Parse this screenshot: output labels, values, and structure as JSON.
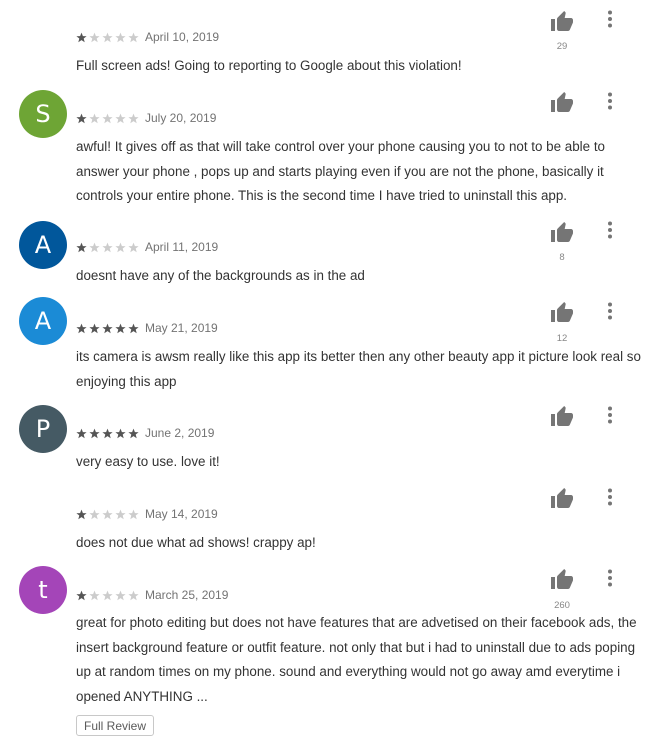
{
  "colors": {
    "star_on": "#555555",
    "star_off": "#cccccc",
    "icon": "#757575"
  },
  "reviews": [
    {
      "initial": "",
      "avatar_color": "",
      "rating": 1,
      "date": "April 10, 2019",
      "likes": "29",
      "text": "Full screen ads! Going to reporting to Google about this violation!"
    },
    {
      "initial": "S",
      "avatar_color": "#6ea535",
      "rating": 1,
      "date": "July 20, 2019",
      "likes": "",
      "text": "awful! It gives off as that will take control over your phone causing you to not to be able to answer your phone , pops up and starts playing even if you are not the phone, basically it controls your entire phone. This is the second time I have tried to uninstall this app."
    },
    {
      "initial": "A",
      "avatar_color": "#01579b",
      "rating": 1,
      "date": "April 11, 2019",
      "likes": "8",
      "text": "doesnt have any of the backgrounds as in the ad"
    },
    {
      "initial": "A",
      "avatar_color": "#1b8bd6",
      "rating": 5,
      "date": "May 21, 2019",
      "likes": "12",
      "text": "its camera is awsm really like this app its better then any other beauty app it picture look real so enjoying this app"
    },
    {
      "initial": "P",
      "avatar_color": "#455a64",
      "rating": 5,
      "date": "June 2, 2019",
      "likes": "",
      "text": "very easy to use. love it!"
    },
    {
      "initial": "",
      "avatar_color": "",
      "rating": 1,
      "date": "May 14, 2019",
      "likes": "",
      "text": "does not due what ad shows! crappy ap!"
    },
    {
      "initial": "t",
      "avatar_color": "#a445b8",
      "rating": 1,
      "date": "March 25, 2019",
      "likes": "260",
      "text": "great for photo editing but does not have features that are advetised on their facebook ads, the insert background feature or outfit feature. not only that but i had to uninstall due to ads poping up at random times on my phone. sound and everything would not go away amd everytime i opened ANYTHING ..."
    }
  ],
  "full_review_label": "Full Review"
}
